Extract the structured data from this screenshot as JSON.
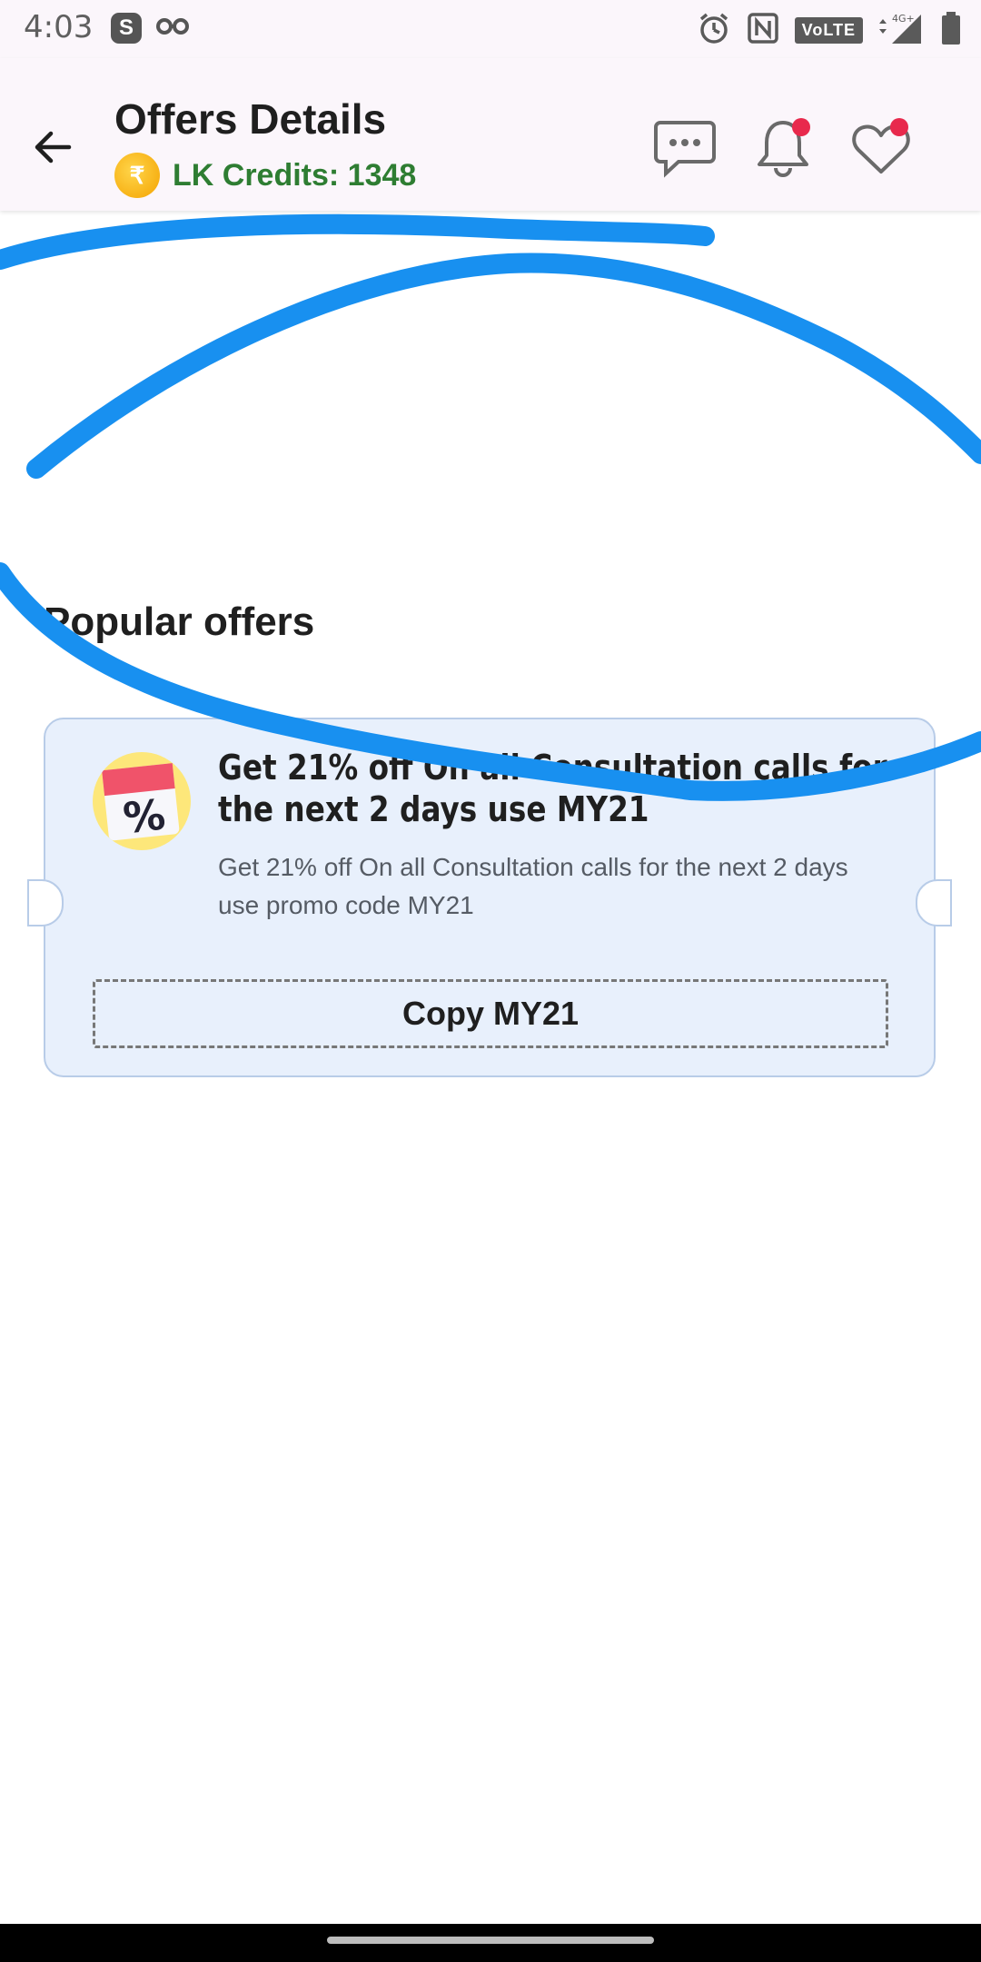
{
  "status_bar": {
    "time": "4:03",
    "app_badge": "S",
    "network_label": "VoLTE",
    "network_type": "4G+"
  },
  "header": {
    "title": "Offers Details",
    "credits_label": "LK Credits: 1348",
    "coin_symbol": "₹"
  },
  "section": {
    "title": "Popular offers"
  },
  "offer": {
    "icon_symbol": "%",
    "title": "Get 21% off On all Consultation calls for the next 2 days use MY21",
    "description": "Get 21% off On all Consultation calls for the next 2 days use promo code MY21",
    "copy_label": "Copy MY21"
  },
  "colors": {
    "accent_green": "#2e7d32",
    "notification_dot": "#e8294c",
    "scribble_blue": "#1890f0",
    "card_background": "#e8f0fc"
  }
}
